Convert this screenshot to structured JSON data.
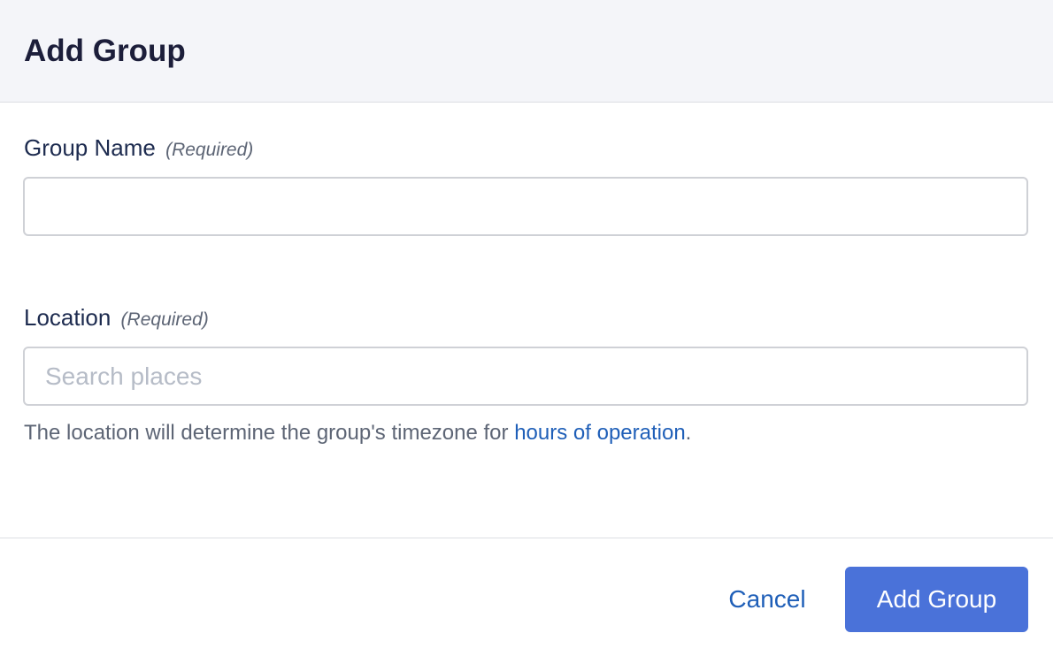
{
  "dialog": {
    "title": "Add Group"
  },
  "fields": {
    "group_name": {
      "label": "Group Name",
      "required_text": "(Required)",
      "value": "",
      "placeholder": ""
    },
    "location": {
      "label": "Location",
      "required_text": "(Required)",
      "value": "",
      "placeholder": "Search places",
      "helper_prefix": "The location will determine the group's timezone for ",
      "helper_link": "hours of operation",
      "helper_suffix": "."
    }
  },
  "footer": {
    "cancel_label": "Cancel",
    "submit_label": "Add Group"
  },
  "colors": {
    "header_bg": "#f4f5f9",
    "primary": "#4a72d9",
    "link": "#1f5fb8",
    "title_text": "#1c1e3a"
  }
}
